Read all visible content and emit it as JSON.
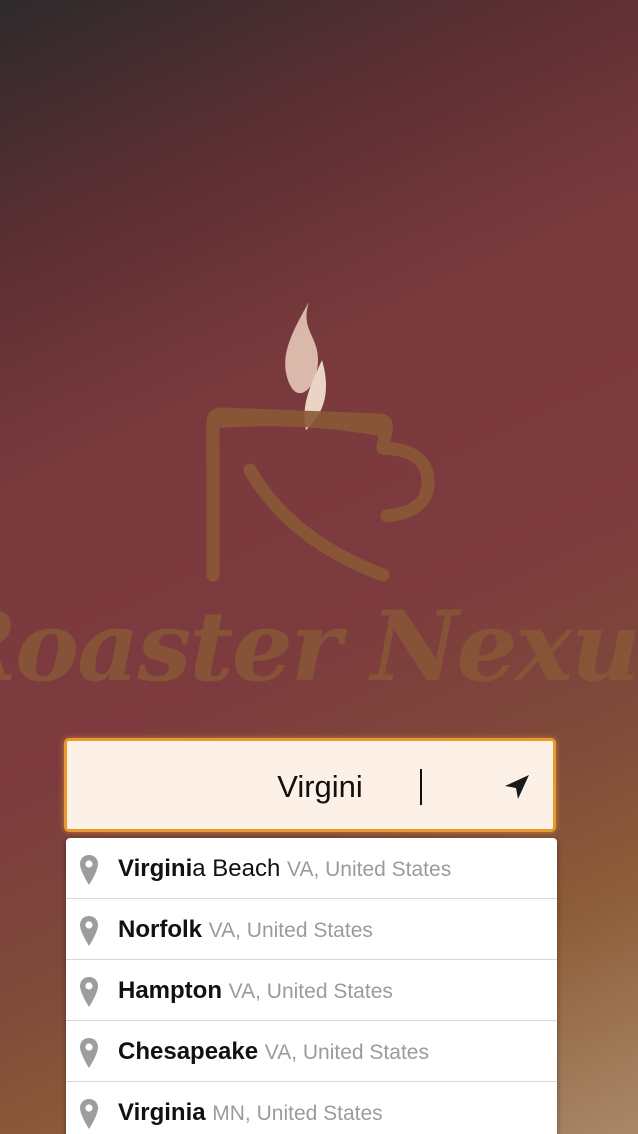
{
  "brand": {
    "name": "Roaster Nexus"
  },
  "search": {
    "value": "Virgini",
    "location_icon": "navigation-arrow-icon"
  },
  "suggestions": [
    {
      "match": "Virgini",
      "rest": "a Beach",
      "region": "VA, United States",
      "icon": "map-pin-icon"
    },
    {
      "match": "Norfolk",
      "rest": "",
      "region": "VA, United States",
      "icon": "map-pin-icon"
    },
    {
      "match": "Hampton",
      "rest": "",
      "region": "VA, United States",
      "icon": "map-pin-icon"
    },
    {
      "match": "Chesapeake",
      "rest": "",
      "region": "VA, United States",
      "icon": "map-pin-icon"
    },
    {
      "match": "Virginia",
      "rest": "",
      "region": "MN, United States",
      "icon": "map-pin-icon"
    }
  ],
  "colors": {
    "accent": "#e79a2d",
    "logo": "#8a5a36",
    "steam": "#e8cfc0"
  }
}
